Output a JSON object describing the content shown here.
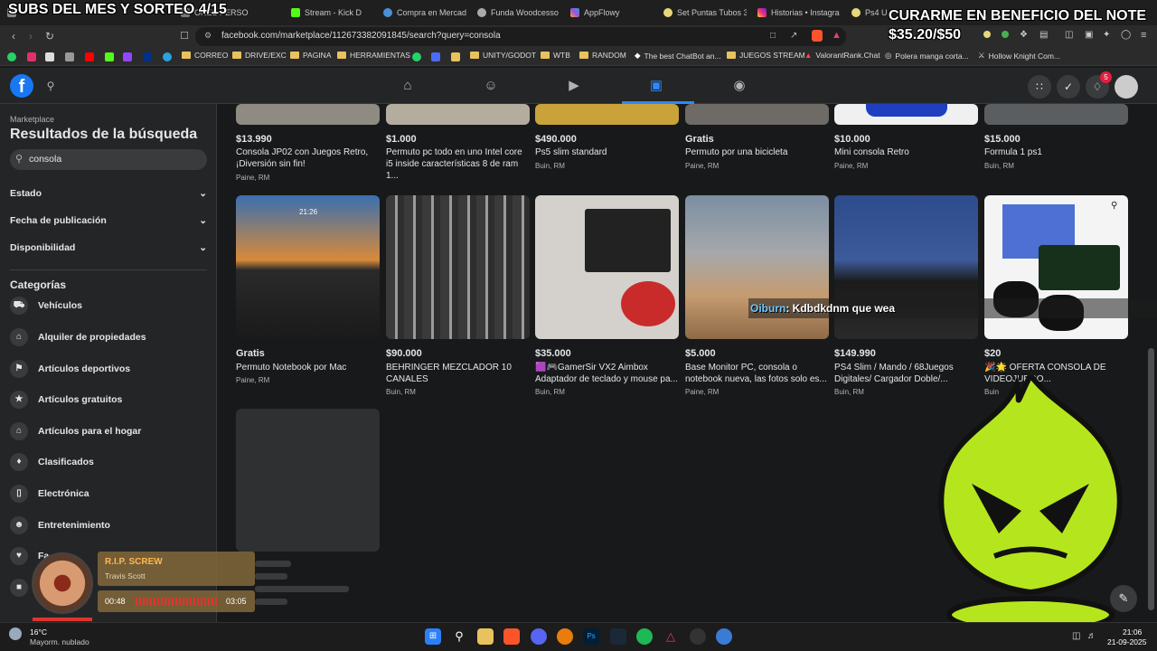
{
  "browser": {
    "tabs": [
      "SUBS DEL MES Y SORTEO 4/15",
      "ONES PERSO",
      "Stream - Kick D",
      "Compra en Mercad",
      "Funda Woodcesso",
      "AppFlowy",
      "Set Puntas Tubos 3/",
      "Historias • Instagra",
      "Ps4 Usad"
    ],
    "url": "facebook.com/marketplace/112673382091845/search?query=consola",
    "bookmarks": [
      "CORREO",
      "DRIVE/EXC",
      "PAGINA",
      "HERRAMIENTAS",
      "UNITY/GODOT",
      "WTB",
      "RANDOM",
      "The best ChatBot an...",
      "JUEGOS STREAM",
      "ValorantRank.Chat",
      "Polera manga corta...",
      "Hollow Knight Com..."
    ]
  },
  "stream_overlay": {
    "top_left": "SUBS DEL MES Y SORTEO 4/15",
    "goal_title": "CURARME EN BENEFICIO DEL NOTE",
    "goal_amount": "$35.20/$50",
    "chat_user": "Oiburn",
    "chat_message": ": Kdbdkdnm que wea",
    "song_title": "R.I.P. SCREW",
    "song_artist": "Travis Scott",
    "song_elapsed": "00:48",
    "song_total": "03:05"
  },
  "fbnav": {
    "notification_count": "5"
  },
  "sidebar": {
    "section": "Marketplace",
    "heading": "Resultados de la búsqueda",
    "search_value": "consola",
    "filters": [
      "Estado",
      "Fecha de publicación",
      "Disponibilidad"
    ],
    "categories_heading": "Categorías",
    "categories": [
      "Vehículos",
      "Alquiler de propiedades",
      "Artículos deportivos",
      "Artículos gratuitos",
      "Artículos para el hogar",
      "Clasificados",
      "Electrónica",
      "Entretenimiento",
      "Fa"
    ]
  },
  "listings_row1": [
    {
      "price": "$13.990",
      "title": "Consola JP02 con Juegos Retro, ¡Diversión sin fin!",
      "location": "Paine, RM"
    },
    {
      "price": "$1.000",
      "title": "Permuto pc todo en uno Intel core i5 inside características 8 de ram 1...",
      "location": ""
    },
    {
      "price": "$490.000",
      "title": "Ps5 slim standard",
      "location": "Buin, RM"
    },
    {
      "price": "Gratis",
      "title": "Permuto por una bicicleta",
      "location": "Paine, RM"
    },
    {
      "price": "$10.000",
      "title": "Mini consola Retro",
      "location": "Paine, RM"
    },
    {
      "price": "$15.000",
      "title": "Formula 1 ps1",
      "location": "Buin, RM"
    }
  ],
  "listings_row2": [
    {
      "price": "Gratis",
      "title": "Permuto Notebook por Mac",
      "location": "Paine, RM",
      "img_text": "21:26"
    },
    {
      "price": "$90.000",
      "title": "BEHRINGER MEZCLADOR 10 CANALES",
      "location": "Buin, RM"
    },
    {
      "price": "$35.000",
      "title": "🟪🎮GamerSir VX2 Aimbox Adaptador de teclado y mouse pa...",
      "location": "Buin, RM"
    },
    {
      "price": "$5.000",
      "title": "Base Monitor PC, consola o notebook nueva, las fotos solo es...",
      "location": "Paine, RM"
    },
    {
      "price": "$149.990",
      "title": "PS4 Slim / Mando / 68Juegos Digitales/ Cargador Doble/...",
      "location": "Buin, RM"
    },
    {
      "price": "$20",
      "title": "🎉🌟 OFERTA CONSOLA DE VIDEOJUEGO...",
      "location": "Buin"
    }
  ],
  "taskbar": {
    "weather_temp": "16°C",
    "weather_desc": "Mayorm. nublado",
    "time": "21:06",
    "date": "21-09-2025"
  },
  "colors": {
    "fb_blue": "#1877f2",
    "bg": "#18191a",
    "card": "#242526",
    "overlay_green": "#b5e61d"
  }
}
